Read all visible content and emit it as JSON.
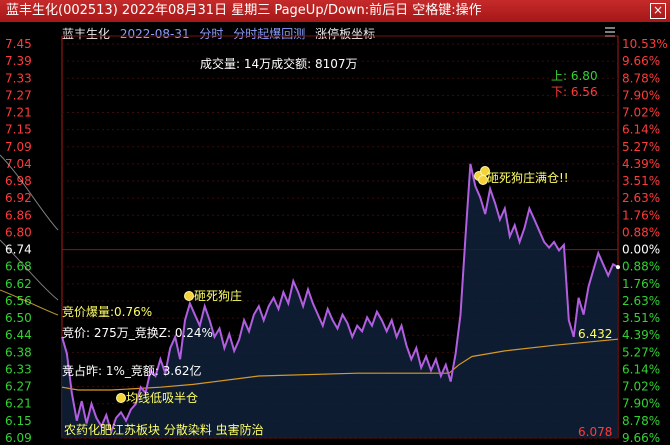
{
  "window": {
    "title": "蓝丰生化(002513) 2022年08月31日 星期三 PageUp/Down:前后日 空格键:操作",
    "close_label": "×"
  },
  "header": {
    "stock_name": "蓝丰生化",
    "date": "2022-08-31",
    "tabs": [
      "分时",
      "分时起爆回测",
      "涨停板坐标"
    ]
  },
  "volume_text": "成交量: 14万成交额: 8107万",
  "prices": {
    "upper": "上: 6.80",
    "lower": "下: 6.56",
    "avg_end": "6.432",
    "low_mark": "6.078"
  },
  "annotations": {
    "auction_burst": "竞价爆量:0.76%",
    "auction_detail": "竞价: 275万_竞换Z: 0.24%",
    "auction_share": "竞占昨: 1%_竞额: 3.62亿",
    "smash": "砸死狗庄",
    "avg_low_half": "均线低吸半仓",
    "limit_full": "砸死狗庄满仓!!",
    "concepts": "农药化肥江苏板块 分散染料 虫害防治"
  },
  "colors": {
    "up": "#ff3b3b",
    "down": "#33d233",
    "neutral": "#ffffff",
    "price_line": "#b15fe0",
    "avg_line": "#d89a24",
    "note": "#ffff66",
    "title_bg": "#b21f1f"
  },
  "chart_data": {
    "type": "line",
    "title": "",
    "xlabel": "",
    "ylabel": "",
    "ylim": [
      6.078,
      7.489
    ],
    "prev_close": 6.74,
    "y_ticks_left": [
      "7.45",
      "7.39",
      "7.33",
      "7.27",
      "7.21",
      "7.15",
      "7.09",
      "7.04",
      "6.98",
      "6.92",
      "6.86",
      "6.80",
      "6.74",
      "6.68",
      "6.62",
      "6.56",
      "6.50",
      "6.44",
      "6.38",
      "6.33",
      "6.27",
      "6.21",
      "6.15",
      "6.09"
    ],
    "y_ticks_right": [
      "10.53%",
      "9.66%",
      "8.78%",
      "7.90%",
      "7.02%",
      "6.14%",
      "5.27%",
      "4.39%",
      "3.51%",
      "2.63%",
      "1.76%",
      "0.88%",
      "0.00%",
      "0.88%",
      "1.76%",
      "2.63%",
      "3.51%",
      "4.39%",
      "5.27%",
      "6.14%",
      "7.02%",
      "7.90%",
      "8.78%",
      "9.66%"
    ],
    "series": [
      {
        "key": "price",
        "points": [
          [
            0,
            6.44
          ],
          [
            3,
            6.38
          ],
          [
            6,
            6.24
          ],
          [
            9,
            6.14
          ],
          [
            12,
            6.21
          ],
          [
            15,
            6.13
          ],
          [
            18,
            6.2
          ],
          [
            21,
            6.15
          ],
          [
            24,
            6.12
          ],
          [
            27,
            6.16
          ],
          [
            30,
            6.1
          ],
          [
            33,
            6.15
          ],
          [
            36,
            6.17
          ],
          [
            39,
            6.14
          ],
          [
            42,
            6.18
          ],
          [
            45,
            6.2
          ],
          [
            48,
            6.26
          ],
          [
            51,
            6.24
          ],
          [
            54,
            6.32
          ],
          [
            57,
            6.3
          ],
          [
            60,
            6.36
          ],
          [
            63,
            6.31
          ],
          [
            66,
            6.4
          ],
          [
            69,
            6.44
          ],
          [
            72,
            6.36
          ],
          [
            75,
            6.5
          ],
          [
            78,
            6.56
          ],
          [
            81,
            6.52
          ],
          [
            84,
            6.48
          ],
          [
            87,
            6.55
          ],
          [
            90,
            6.5
          ],
          [
            93,
            6.44
          ],
          [
            96,
            6.47
          ],
          [
            99,
            6.4
          ],
          [
            102,
            6.45
          ],
          [
            105,
            6.39
          ],
          [
            108,
            6.43
          ],
          [
            111,
            6.5
          ],
          [
            114,
            6.46
          ],
          [
            117,
            6.52
          ],
          [
            120,
            6.55
          ],
          [
            123,
            6.5
          ],
          [
            126,
            6.55
          ],
          [
            129,
            6.58
          ],
          [
            132,
            6.54
          ],
          [
            135,
            6.6
          ],
          [
            138,
            6.56
          ],
          [
            141,
            6.64
          ],
          [
            144,
            6.6
          ],
          [
            147,
            6.55
          ],
          [
            150,
            6.61
          ],
          [
            153,
            6.56
          ],
          [
            156,
            6.52
          ],
          [
            159,
            6.48
          ],
          [
            162,
            6.54
          ],
          [
            165,
            6.5
          ],
          [
            168,
            6.47
          ],
          [
            171,
            6.52
          ],
          [
            174,
            6.49
          ],
          [
            177,
            6.44
          ],
          [
            180,
            6.48
          ],
          [
            183,
            6.46
          ],
          [
            186,
            6.51
          ],
          [
            189,
            6.48
          ],
          [
            192,
            6.53
          ],
          [
            195,
            6.5
          ],
          [
            198,
            6.46
          ],
          [
            201,
            6.5
          ],
          [
            204,
            6.44
          ],
          [
            207,
            6.48
          ],
          [
            210,
            6.41
          ],
          [
            213,
            6.36
          ],
          [
            216,
            6.4
          ],
          [
            219,
            6.33
          ],
          [
            222,
            6.37
          ],
          [
            225,
            6.32
          ],
          [
            228,
            6.36
          ],
          [
            231,
            6.3
          ],
          [
            234,
            6.34
          ],
          [
            237,
            6.28
          ],
          [
            240,
            6.38
          ],
          [
            243,
            6.52
          ],
          [
            246,
            6.8
          ],
          [
            249,
            7.06
          ],
          [
            252,
            6.98
          ],
          [
            255,
            6.94
          ],
          [
            258,
            6.88
          ],
          [
            261,
            6.97
          ],
          [
            264,
            6.92
          ],
          [
            267,
            6.86
          ],
          [
            270,
            6.9
          ],
          [
            273,
            6.8
          ],
          [
            276,
            6.84
          ],
          [
            279,
            6.78
          ],
          [
            282,
            6.83
          ],
          [
            285,
            6.9
          ],
          [
            288,
            6.86
          ],
          [
            291,
            6.82
          ],
          [
            294,
            6.78
          ],
          [
            297,
            6.76
          ],
          [
            300,
            6.78
          ],
          [
            303,
            6.75
          ],
          [
            306,
            6.77
          ],
          [
            309,
            6.5
          ],
          [
            312,
            6.44
          ],
          [
            315,
            6.58
          ],
          [
            318,
            6.52
          ],
          [
            321,
            6.62
          ],
          [
            324,
            6.68
          ],
          [
            327,
            6.74
          ],
          [
            330,
            6.7
          ],
          [
            333,
            6.66
          ],
          [
            336,
            6.7
          ],
          [
            339,
            6.69
          ]
        ]
      },
      {
        "key": "average",
        "points": [
          [
            0,
            6.26
          ],
          [
            10,
            6.25
          ],
          [
            30,
            6.25
          ],
          [
            60,
            6.26
          ],
          [
            80,
            6.27
          ],
          [
            120,
            6.3
          ],
          [
            180,
            6.31
          ],
          [
            236,
            6.31
          ],
          [
            242,
            6.34
          ],
          [
            250,
            6.37
          ],
          [
            270,
            6.39
          ],
          [
            300,
            6.41
          ],
          [
            339,
            6.432
          ]
        ]
      }
    ]
  }
}
